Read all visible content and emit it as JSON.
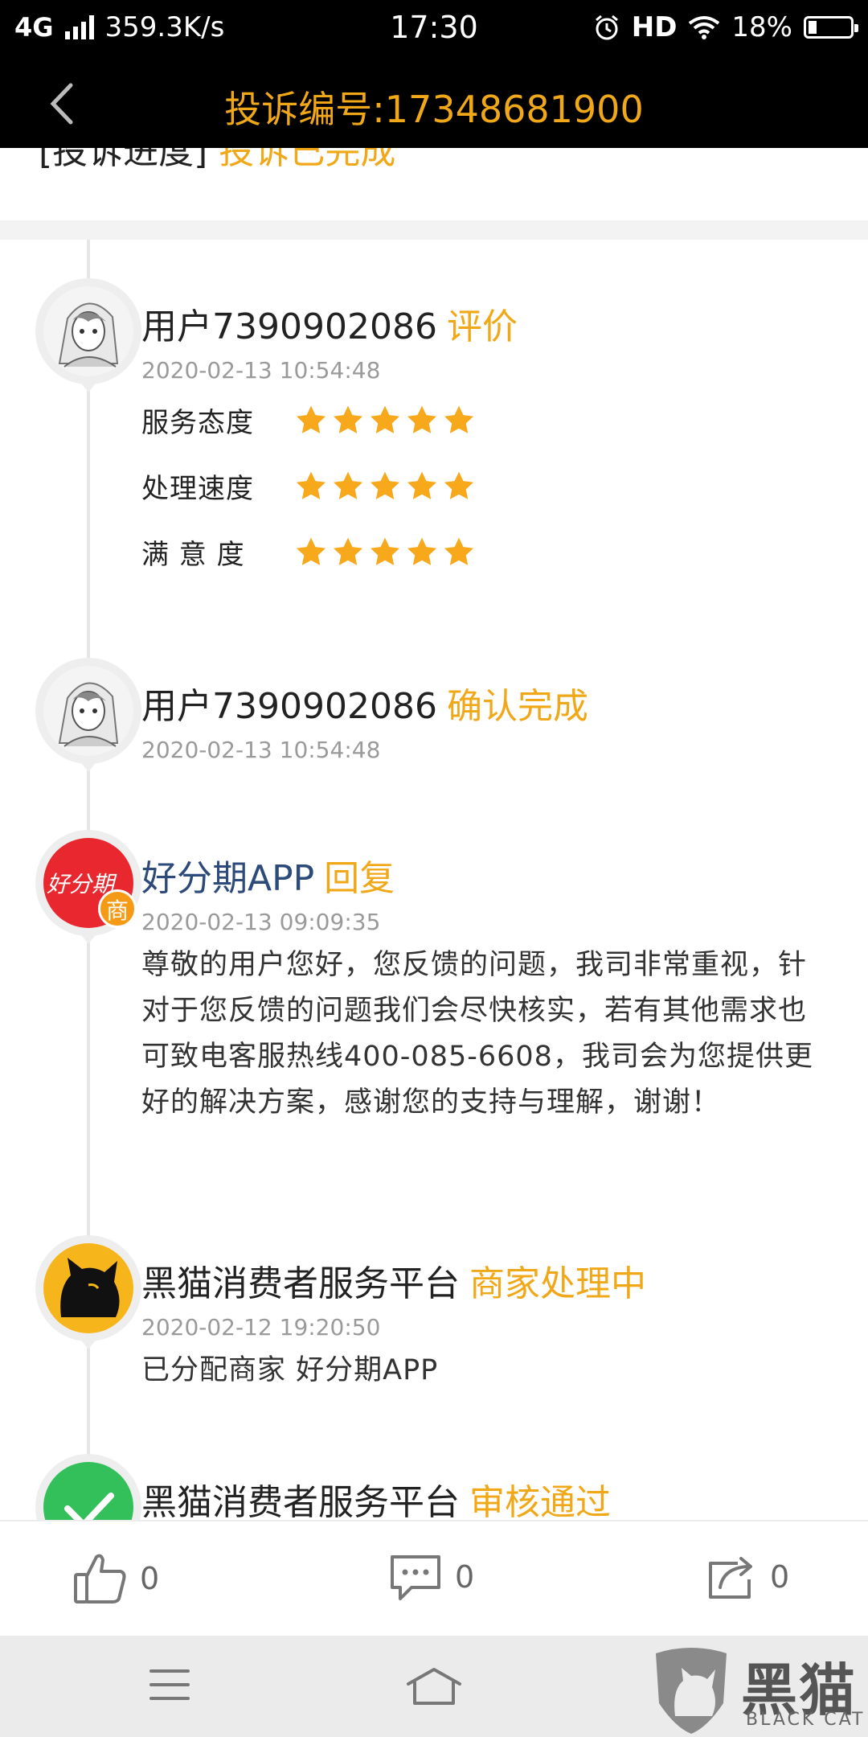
{
  "status_bar": {
    "network": "4G",
    "speed": "359.3K/s",
    "time": "17:30",
    "hd": "HD",
    "battery": "18%"
  },
  "header": {
    "title": "投诉编号:17348681900"
  },
  "top_strip": {
    "label": "[投诉进度]",
    "value": "投诉已完成"
  },
  "timeline": [
    {
      "name": "用户7390902086",
      "action": "评价",
      "time": "2020-02-13 10:54:48",
      "ratings": [
        {
          "label": "服务态度",
          "stars": 5
        },
        {
          "label": "处理速度",
          "stars": 5
        },
        {
          "label": "满 意 度",
          "stars": 5
        }
      ]
    },
    {
      "name": "用户7390902086",
      "action": "确认完成",
      "time": "2020-02-13 10:54:48"
    },
    {
      "name": "好分期APP",
      "action": "回复",
      "time": "2020-02-13 09:09:35",
      "badge": "商",
      "logo_text": "好分期",
      "body": "尊敬的用户您好，您反馈的问题，我司非常重视，针对于您反馈的问题我们会尽快核实，若有其他需求也可致电客服热线400-085-6608，我司会为您提供更好的解决方案，感谢您的支持与理解，谢谢！"
    },
    {
      "name": "黑猫消费者服务平台",
      "action": "商家处理中",
      "time": "2020-02-12 19:20:50",
      "body": "已分配商家 好分期APP"
    },
    {
      "name": "黑猫消费者服务平台",
      "action": "审核通过"
    }
  ],
  "action_bar": {
    "likes": "0",
    "comments": "0",
    "shares": "0"
  },
  "watermark": {
    "cn": "黑猫",
    "en": "BLACK CAT"
  },
  "colors": {
    "accent": "#f0a818",
    "brand_blue": "#2c4a7a",
    "header_bg": "#000000"
  }
}
